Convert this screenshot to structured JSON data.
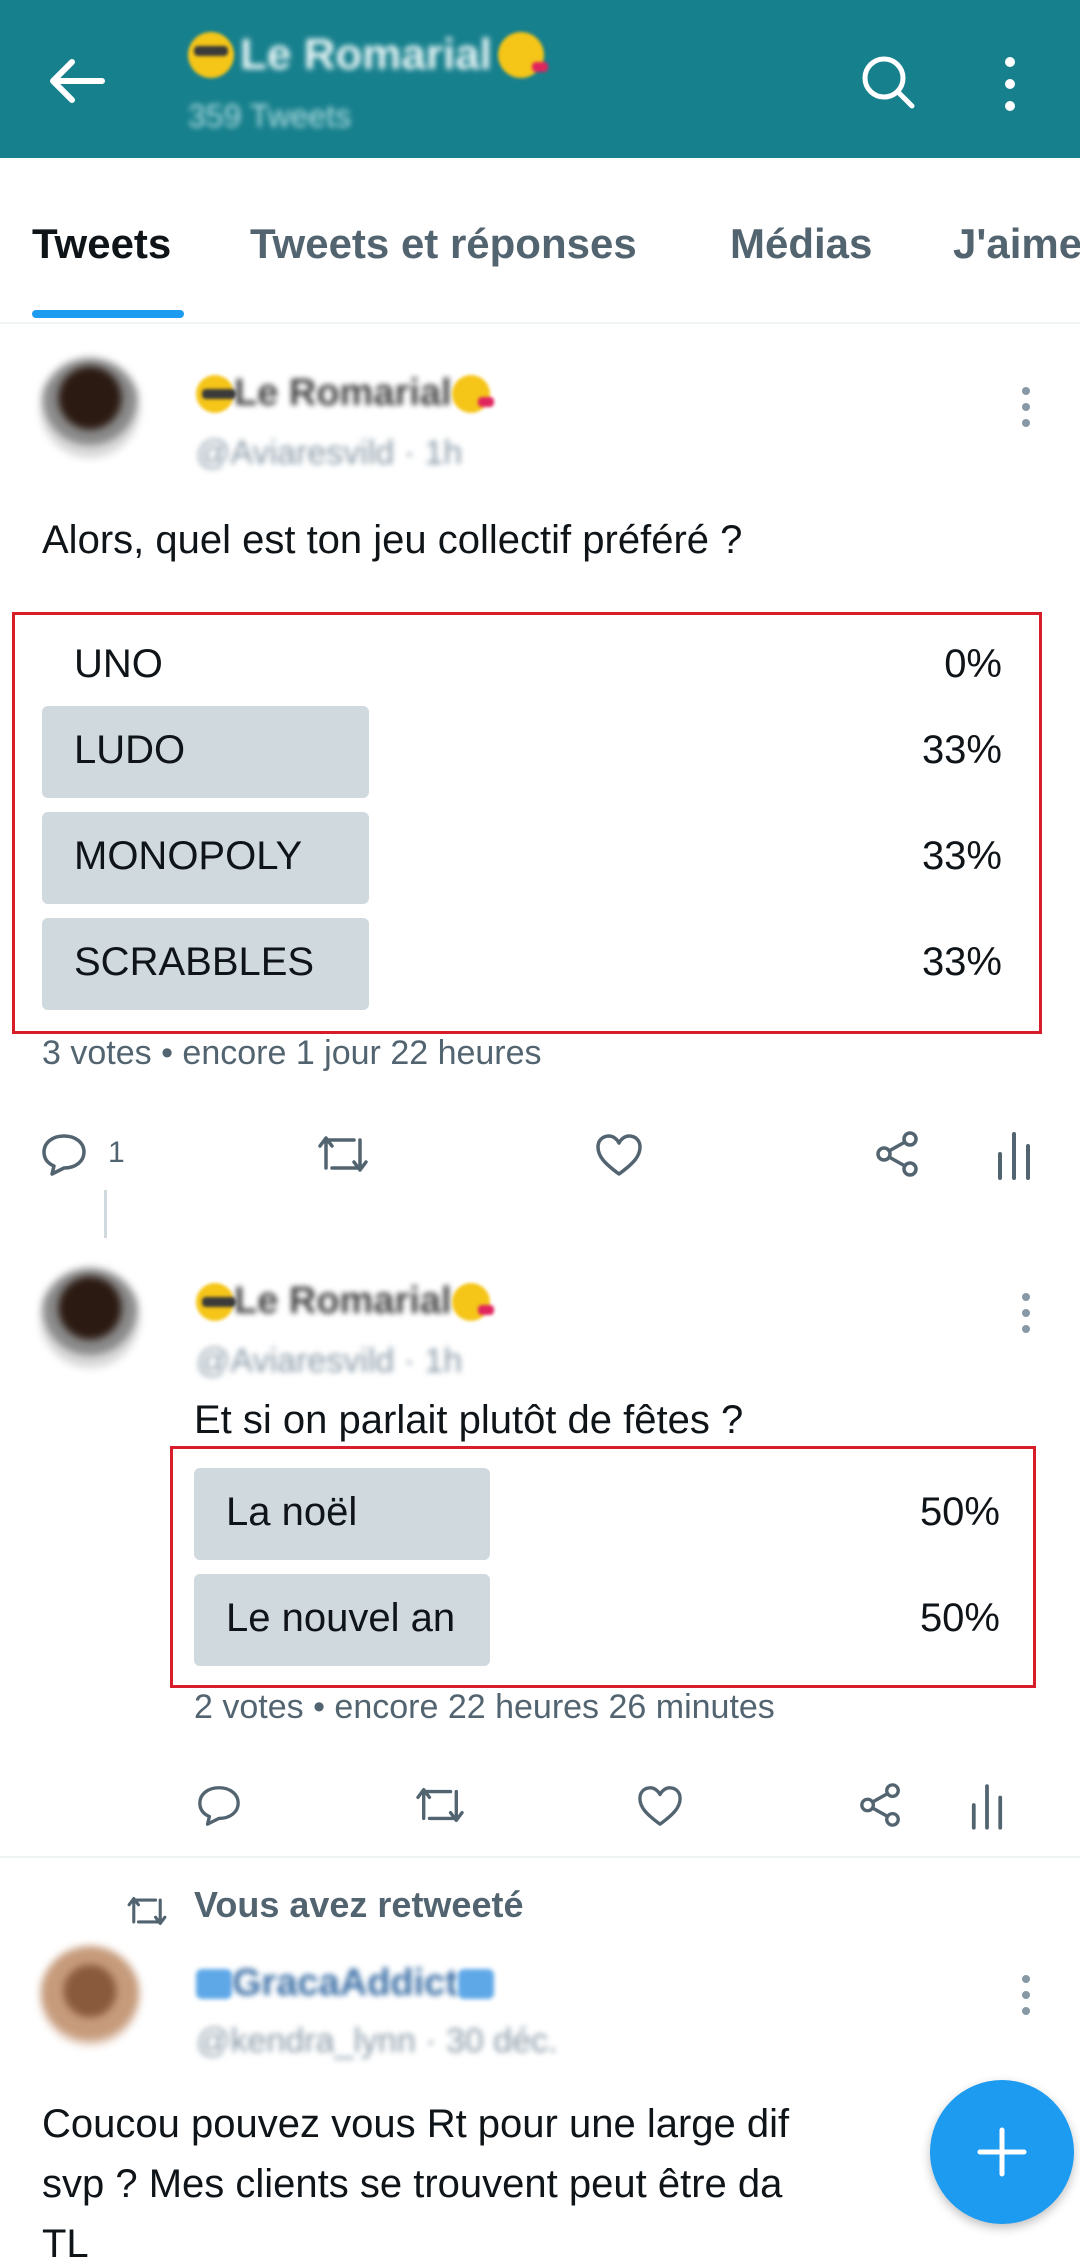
{
  "header": {
    "title": "Le Romarial",
    "subtitle": "359 Tweets",
    "bg_color": "#17808d"
  },
  "tabs": [
    {
      "label": "Tweets",
      "active": true
    },
    {
      "label": "Tweets et réponses",
      "active": false
    },
    {
      "label": "Médias",
      "active": false
    },
    {
      "label": "J'aime",
      "active": false
    }
  ],
  "tweets": [
    {
      "author": "Le Romarial",
      "handle": "@Aviaresvild · 1h",
      "text": "Alors, quel est ton jeu collectif préféré ?",
      "poll": {
        "options": [
          {
            "label": "UNO",
            "pct": "0%",
            "fraction": 0.0
          },
          {
            "label": "LUDO",
            "pct": "33%",
            "fraction": 0.33
          },
          {
            "label": "MONOPOLY",
            "pct": "33%",
            "fraction": 0.33
          },
          {
            "label": "SCRABBLES",
            "pct": "33%",
            "fraction": 0.33
          }
        ],
        "meta": "3 votes • encore 1 jour 22 heures"
      },
      "reply_count": "1"
    },
    {
      "author": "Le Romarial",
      "handle": "@Aviaresvild · 1h",
      "text": "Et si on parlait plutôt de fêtes ?",
      "poll": {
        "options": [
          {
            "label": "La noël",
            "pct": "50%",
            "fraction": 0.5
          },
          {
            "label": "Le nouvel an",
            "pct": "50%",
            "fraction": 0.5
          }
        ],
        "meta": "2 votes • encore 22 heures 26 minutes"
      }
    },
    {
      "retweet_label": "Vous avez retweeté",
      "author": "GracaAddict",
      "handle": "@kendra_lynn · 30 déc.",
      "text_lines": [
        "Coucou pouvez vous Rt pour une large dif",
        "svp ? Mes clients se trouvent peut être da",
        "TL"
      ]
    }
  ],
  "colors": {
    "accent": "#1d9bf0",
    "poll_bar": "#cfd9de",
    "highlight_box": "#d71d2a"
  }
}
